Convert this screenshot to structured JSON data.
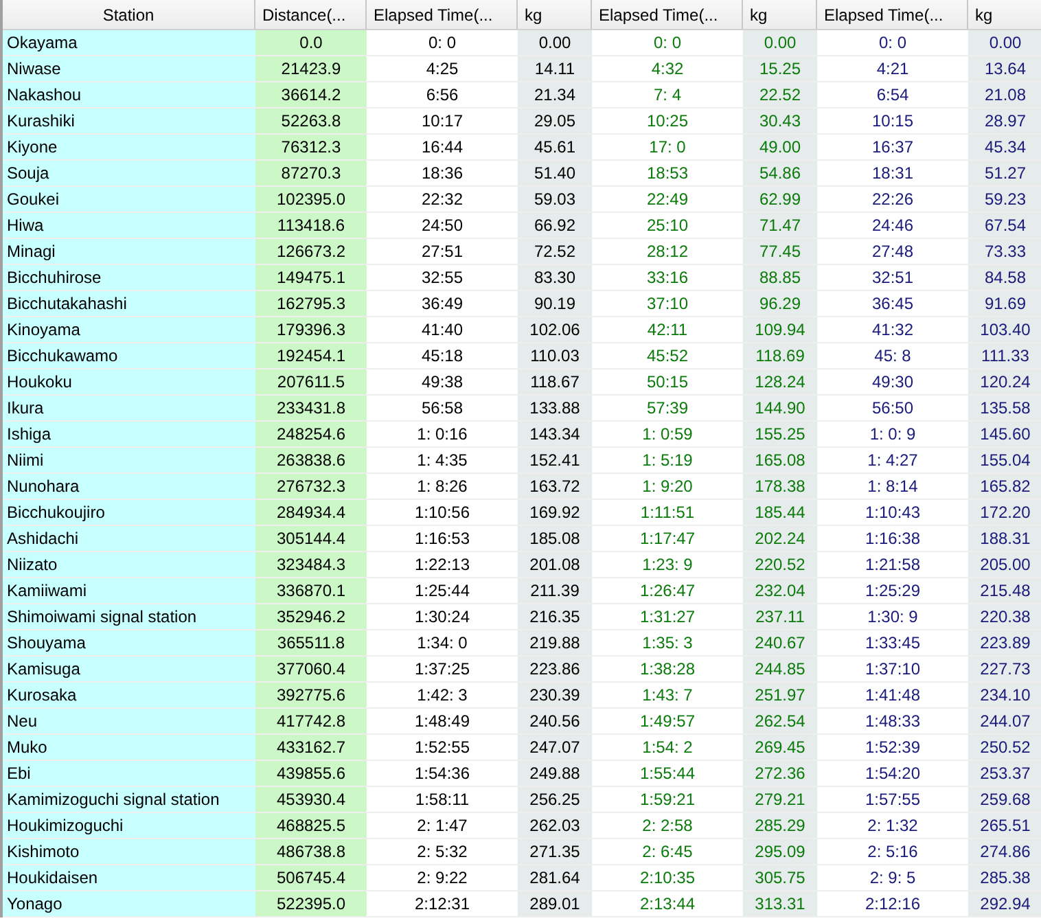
{
  "table": {
    "columns": [
      {
        "label": "Station",
        "kind": "station"
      },
      {
        "label": "Distance(...",
        "kind": "distance"
      },
      {
        "label": "Elapsed Time(...",
        "kind": "time",
        "color": "#000000"
      },
      {
        "label": "kg",
        "kind": "kg",
        "color": "#000000"
      },
      {
        "label": "Elapsed Time(...",
        "kind": "time",
        "color": "#0a7a0a"
      },
      {
        "label": "kg",
        "kind": "kg",
        "color": "#0a7a0a"
      },
      {
        "label": "Elapsed Time(...",
        "kind": "time",
        "color": "#1a1a7a"
      },
      {
        "label": "kg",
        "kind": "kg",
        "color": "#1a1a7a"
      }
    ],
    "rows": [
      [
        "Okayama",
        "0.0",
        "0: 0",
        "0.00",
        "0: 0",
        "0.00",
        "0: 0",
        "0.00"
      ],
      [
        "Niwase",
        "21423.9",
        "4:25",
        "14.11",
        "4:32",
        "15.25",
        "4:21",
        "13.64"
      ],
      [
        "Nakashou",
        "36614.2",
        "6:56",
        "21.34",
        "7: 4",
        "22.52",
        "6:54",
        "21.08"
      ],
      [
        "Kurashiki",
        "52263.8",
        "10:17",
        "29.05",
        "10:25",
        "30.43",
        "10:15",
        "28.97"
      ],
      [
        "Kiyone",
        "76312.3",
        "16:44",
        "45.61",
        "17: 0",
        "49.00",
        "16:37",
        "45.34"
      ],
      [
        "Souja",
        "87270.3",
        "18:36",
        "51.40",
        "18:53",
        "54.86",
        "18:31",
        "51.27"
      ],
      [
        "Goukei",
        "102395.0",
        "22:32",
        "59.03",
        "22:49",
        "62.99",
        "22:26",
        "59.23"
      ],
      [
        "Hiwa",
        "113418.6",
        "24:50",
        "66.92",
        "25:10",
        "71.47",
        "24:46",
        "67.54"
      ],
      [
        "Minagi",
        "126673.2",
        "27:51",
        "72.52",
        "28:12",
        "77.45",
        "27:48",
        "73.33"
      ],
      [
        "Bicchuhirose",
        "149475.1",
        "32:55",
        "83.30",
        "33:16",
        "88.85",
        "32:51",
        "84.58"
      ],
      [
        "Bicchutakahashi",
        "162795.3",
        "36:49",
        "90.19",
        "37:10",
        "96.29",
        "36:45",
        "91.69"
      ],
      [
        "Kinoyama",
        "179396.3",
        "41:40",
        "102.06",
        "42:11",
        "109.94",
        "41:32",
        "103.40"
      ],
      [
        "Bicchukawamo",
        "192454.1",
        "45:18",
        "110.03",
        "45:52",
        "118.69",
        "45: 8",
        "111.33"
      ],
      [
        "Houkoku",
        "207611.5",
        "49:38",
        "118.67",
        "50:15",
        "128.24",
        "49:30",
        "120.24"
      ],
      [
        "Ikura",
        "233431.8",
        "56:58",
        "133.88",
        "57:39",
        "144.90",
        "56:50",
        "135.58"
      ],
      [
        "Ishiga",
        "248254.6",
        "1: 0:16",
        "143.34",
        "1: 0:59",
        "155.25",
        "1: 0: 9",
        "145.60"
      ],
      [
        "Niimi",
        "263838.6",
        "1: 4:35",
        "152.41",
        "1: 5:19",
        "165.08",
        "1: 4:27",
        "155.04"
      ],
      [
        "Nunohara",
        "276732.3",
        "1: 8:26",
        "163.72",
        "1: 9:20",
        "178.38",
        "1: 8:14",
        "165.82"
      ],
      [
        "Bicchukoujiro",
        "284934.4",
        "1:10:56",
        "169.92",
        "1:11:51",
        "185.44",
        "1:10:43",
        "172.20"
      ],
      [
        "Ashidachi",
        "305144.4",
        "1:16:53",
        "185.08",
        "1:17:47",
        "202.24",
        "1:16:38",
        "188.31"
      ],
      [
        "Niizato",
        "323484.3",
        "1:22:13",
        "201.08",
        "1:23: 9",
        "220.52",
        "1:21:58",
        "205.00"
      ],
      [
        "Kamiiwami",
        "336870.1",
        "1:25:44",
        "211.39",
        "1:26:47",
        "232.04",
        "1:25:29",
        "215.48"
      ],
      [
        "Shimoiwami signal station",
        "352946.2",
        "1:30:24",
        "216.35",
        "1:31:27",
        "237.11",
        "1:30: 9",
        "220.38"
      ],
      [
        "Shouyama",
        "365511.8",
        "1:34: 0",
        "219.88",
        "1:35: 3",
        "240.67",
        "1:33:45",
        "223.89"
      ],
      [
        "Kamisuga",
        "377060.4",
        "1:37:25",
        "223.86",
        "1:38:28",
        "244.85",
        "1:37:10",
        "227.73"
      ],
      [
        "Kurosaka",
        "392775.6",
        "1:42: 3",
        "230.39",
        "1:43: 7",
        "251.97",
        "1:41:48",
        "234.10"
      ],
      [
        "Neu",
        "417742.8",
        "1:48:49",
        "240.56",
        "1:49:57",
        "262.54",
        "1:48:33",
        "244.07"
      ],
      [
        "Muko",
        "433162.7",
        "1:52:55",
        "247.07",
        "1:54: 2",
        "269.45",
        "1:52:39",
        "250.52"
      ],
      [
        "Ebi",
        "439855.6",
        "1:54:36",
        "249.88",
        "1:55:44",
        "272.36",
        "1:54:20",
        "253.37"
      ],
      [
        "Kamimizoguchi signal station",
        "453930.4",
        "1:58:11",
        "256.25",
        "1:59:21",
        "279.21",
        "1:57:55",
        "259.68"
      ],
      [
        "Houkimizoguchi",
        "468825.5",
        "2: 1:47",
        "262.03",
        "2: 2:58",
        "285.29",
        "2: 1:32",
        "265.51"
      ],
      [
        "Kishimoto",
        "486738.8",
        "2: 5:32",
        "271.35",
        "2: 6:45",
        "295.09",
        "2: 5:16",
        "274.86"
      ],
      [
        "Houkidaisen",
        "506745.4",
        "2: 9:22",
        "281.64",
        "2:10:35",
        "305.75",
        "2: 9: 5",
        "285.38"
      ],
      [
        "Yonago",
        "522395.0",
        "2:12:31",
        "289.01",
        "2:13:44",
        "313.31",
        "2:12:16",
        "292.94"
      ]
    ]
  }
}
